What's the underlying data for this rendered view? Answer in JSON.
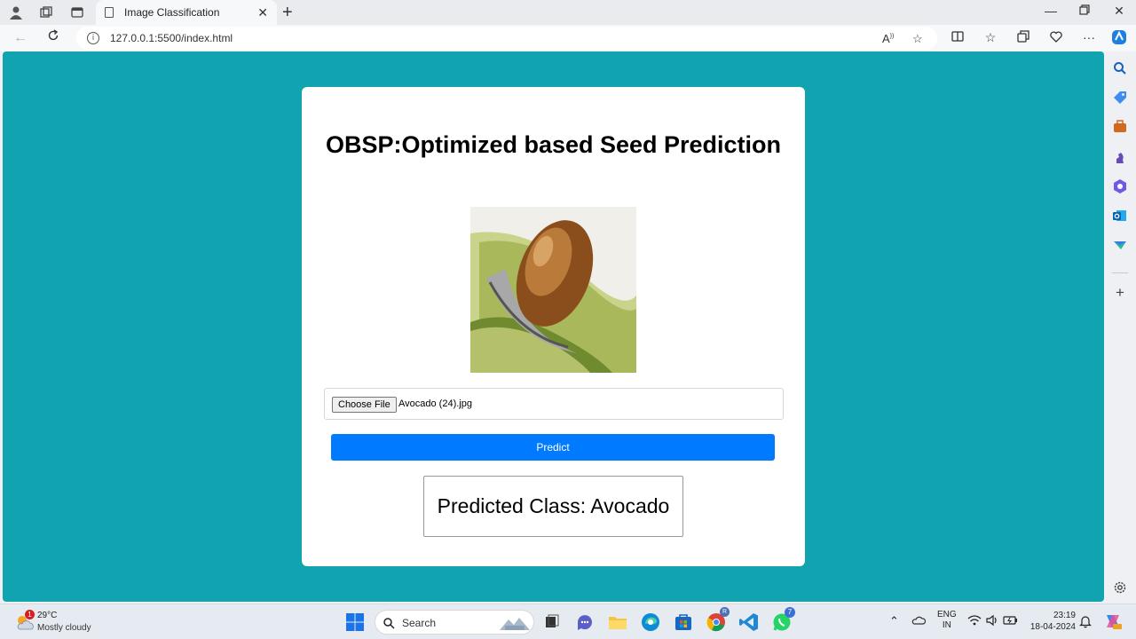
{
  "browser": {
    "tab_title": "Image Classification",
    "url": "127.0.0.1:5500/index.html"
  },
  "page": {
    "title": "OBSP:Optimized based Seed Prediction",
    "file_button_label": "Choose File",
    "file_name": "Avocado (24).jpg",
    "predict_label": "Predict",
    "result_text": "Predicted Class: Avocado"
  },
  "taskbar": {
    "weather_temp": "29°C",
    "weather_condition": "Mostly cloudy",
    "weather_badge": "1",
    "search_label": "Search",
    "lang_line1": "ENG",
    "lang_line2": "IN",
    "time": "23:19",
    "date": "18-04-2024",
    "chrome_badge": "R",
    "whatsapp_badge": "7"
  },
  "colors": {
    "page_background": "#12a3b0",
    "predict_button": "#007bff"
  }
}
